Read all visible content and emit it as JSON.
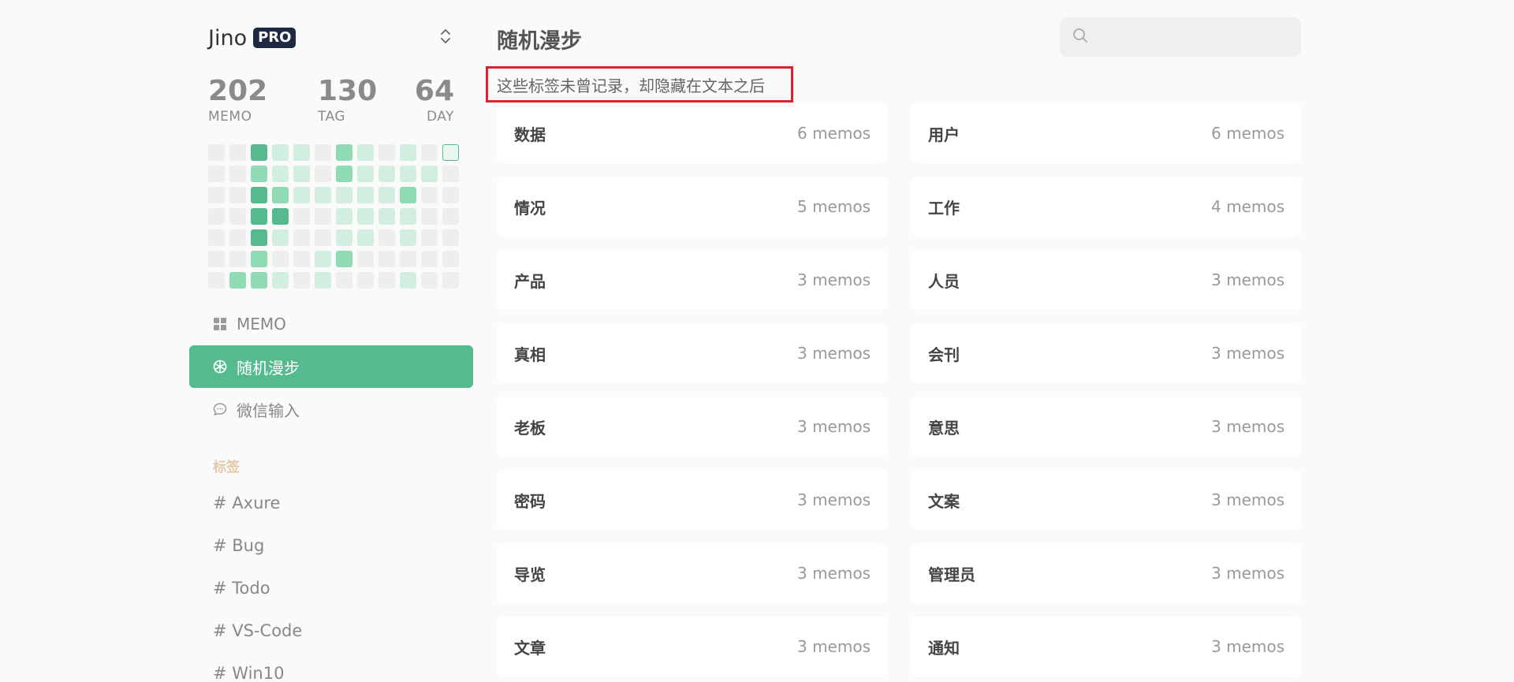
{
  "brand": {
    "name": "Jino",
    "badge": "PRO"
  },
  "stats": [
    {
      "value": "202",
      "label": "MEMO"
    },
    {
      "value": "130",
      "label": "TAG"
    },
    {
      "value": "64",
      "label": "DAY"
    }
  ],
  "heatmap": {
    "colors": {
      "0": "#eeeeee",
      "1": "#d2eedf",
      "2": "#8fdbb4",
      "3": "#55bb8e"
    },
    "columns": [
      [
        0,
        0,
        0,
        0,
        0,
        0,
        0
      ],
      [
        0,
        0,
        0,
        0,
        0,
        0,
        2
      ],
      [
        3,
        2,
        3,
        3,
        3,
        2,
        2
      ],
      [
        1,
        1,
        2,
        3,
        1,
        0,
        1
      ],
      [
        1,
        1,
        1,
        0,
        0,
        0,
        0
      ],
      [
        0,
        0,
        1,
        0,
        0,
        1,
        1
      ],
      [
        2,
        2,
        1,
        1,
        1,
        2,
        0
      ],
      [
        1,
        1,
        1,
        1,
        1,
        0,
        0
      ],
      [
        0,
        1,
        1,
        1,
        0,
        0,
        0
      ],
      [
        1,
        1,
        2,
        1,
        1,
        0,
        1
      ],
      [
        0,
        1,
        0,
        0,
        0,
        0,
        0
      ],
      [
        0,
        0,
        0,
        0,
        0,
        0,
        0
      ]
    ],
    "today": {
      "col": 11,
      "row": 0
    }
  },
  "nav": [
    {
      "label": "MEMO",
      "icon": "grid-icon",
      "active": false
    },
    {
      "label": "随机漫步",
      "icon": "shuffle-icon",
      "active": true
    },
    {
      "label": "微信输入",
      "icon": "chat-icon",
      "active": false
    }
  ],
  "tags_title": "标签",
  "sidebar_tags": [
    "# Axure",
    "# Bug",
    "# Todo",
    "# VS-Code",
    "# Win10"
  ],
  "page_title": "随机漫步",
  "search": {
    "placeholder": ""
  },
  "subtitle": "这些标签未曾记录，却隐藏在文本之后",
  "tag_cards": [
    {
      "name": "数据",
      "count": "6 memos"
    },
    {
      "name": "用户",
      "count": "6 memos"
    },
    {
      "name": "情况",
      "count": "5 memos"
    },
    {
      "name": "工作",
      "count": "4 memos"
    },
    {
      "name": "产品",
      "count": "3 memos"
    },
    {
      "name": "人员",
      "count": "3 memos"
    },
    {
      "name": "真相",
      "count": "3 memos"
    },
    {
      "name": "会刊",
      "count": "3 memos"
    },
    {
      "name": "老板",
      "count": "3 memos"
    },
    {
      "name": "意思",
      "count": "3 memos"
    },
    {
      "name": "密码",
      "count": "3 memos"
    },
    {
      "name": "文案",
      "count": "3 memos"
    },
    {
      "name": "导览",
      "count": "3 memos"
    },
    {
      "name": "管理员",
      "count": "3 memos"
    },
    {
      "name": "文章",
      "count": "3 memos"
    },
    {
      "name": "通知",
      "count": "3 memos"
    }
  ]
}
